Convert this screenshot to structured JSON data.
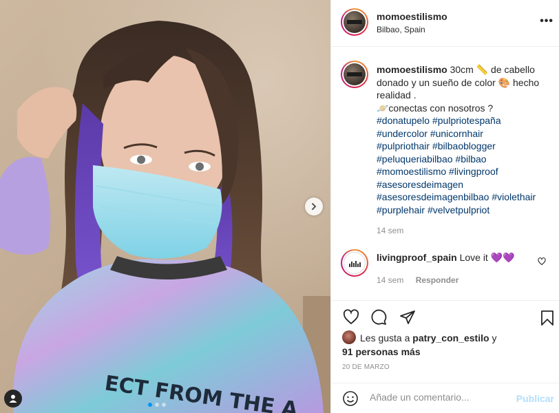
{
  "post": {
    "username": "momoestilismo",
    "location": "Bilbao, Spain",
    "more_label": "•••",
    "caption": {
      "line1": "30cm 📏 de cabello donado y un sueño de color 🎨 hecho realidad .",
      "line2": "🪐conectas con nosotros ?",
      "hashtags": [
        "#donatupelo",
        "#pulpriotespaña",
        "#undercolor",
        "#unicornhair",
        "#pulpriothair",
        "#bilbaoblogger",
        "#peluqueriabilbao",
        "#bilbao",
        "#momoestilismo",
        "#livingproof",
        "#asesoresdeimagen",
        "#asesoresdeimagenbilbao",
        "#violethair",
        "#purplehair",
        "#velvetpulpriot"
      ],
      "time": "14 sem"
    },
    "comment": {
      "username": "livingproof_spain",
      "text": "Love it 💜💜",
      "time": "14 sem",
      "reply_label": "Responder"
    },
    "likes": {
      "prefix": "Les gusta a",
      "liker": "patry_con_estilo",
      "conjunction": "y",
      "others": "91 personas más"
    },
    "date": "20 DE MARZO",
    "add_comment": {
      "placeholder": "Añade un comentario...",
      "post_label": "Publicar"
    }
  },
  "carousel": {
    "slide_count": 3,
    "active_slide": 1
  },
  "colors": {
    "link": "#00376b",
    "accent": "#0095f6",
    "muted": "#8e8e8e",
    "publish_disabled": "#b2dffc"
  },
  "icons": [
    "more-icon",
    "next-arrow-icon",
    "user-tag-icon",
    "heart-icon",
    "comment-icon",
    "share-icon",
    "bookmark-icon",
    "emoji-icon",
    "small-heart-icon"
  ]
}
